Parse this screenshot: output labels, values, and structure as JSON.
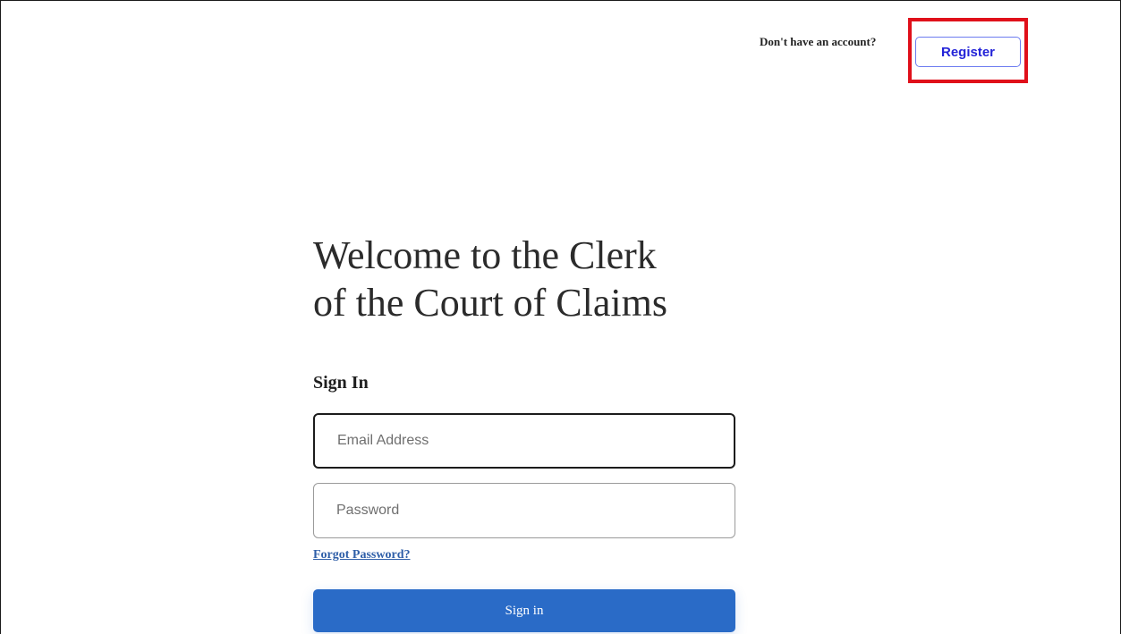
{
  "header": {
    "prompt": "Don't have an account?",
    "register_label": "Register"
  },
  "main": {
    "title_line1": "Welcome to the Clerk",
    "title_line2": "of the Court of Claims",
    "signin_heading": "Sign In",
    "email_placeholder": "Email Address",
    "email_value": "",
    "password_placeholder": "Password",
    "password_value": "",
    "forgot_password_label": "Forgot Password?",
    "signin_button_label": "Sign in"
  },
  "colors": {
    "accent": "#2a6bc7",
    "register_text": "#2323d8",
    "highlight": "#e0101a",
    "link": "#2f5fa8"
  }
}
